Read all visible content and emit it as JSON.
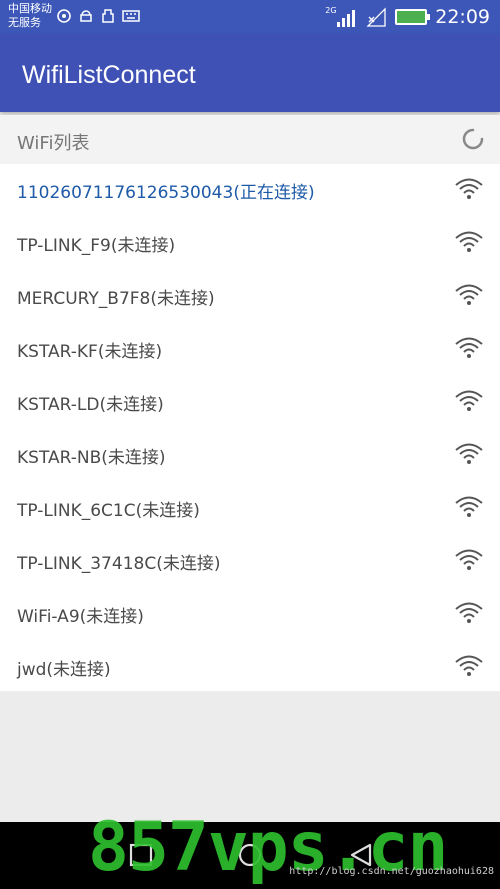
{
  "status_bar": {
    "carrier_line1": "中国移动",
    "carrier_line2": "无服务",
    "network_type": "2G",
    "time": "22:09"
  },
  "app_bar": {
    "title": "WifiListConnect"
  },
  "section": {
    "title": "WiFi列表"
  },
  "wifi_list": [
    {
      "name": "11026071176126530043(正在连接)",
      "connected": true
    },
    {
      "name": "TP-LINK_F9(未连接)",
      "connected": false
    },
    {
      "name": "MERCURY_B7F8(未连接)",
      "connected": false
    },
    {
      "name": "KSTAR-KF(未连接)",
      "connected": false
    },
    {
      "name": "KSTAR-LD(未连接)",
      "connected": false
    },
    {
      "name": "KSTAR-NB(未连接)",
      "connected": false
    },
    {
      "name": "TP-LINK_6C1C(未连接)",
      "connected": false
    },
    {
      "name": "TP-LINK_37418C(未连接)",
      "connected": false
    },
    {
      "name": "WiFi-A9(未连接)",
      "connected": false
    },
    {
      "name": "jwd(未连接)",
      "connected": false
    }
  ],
  "icons": {
    "row_icon": "wifi-signal-icon",
    "loading": "loading-spinner-icon",
    "nav_home": "square-home-icon",
    "nav_circle": "circle-home-icon",
    "nav_back": "triangle-back-icon"
  },
  "colors": {
    "app_bar": "#3f51b5",
    "connected_text": "#1e5aa8",
    "normal_text": "#4a4a4a"
  },
  "watermark": {
    "text": "857vps.cn",
    "url": "http://blog.csdn.net/guozhaohui628"
  }
}
